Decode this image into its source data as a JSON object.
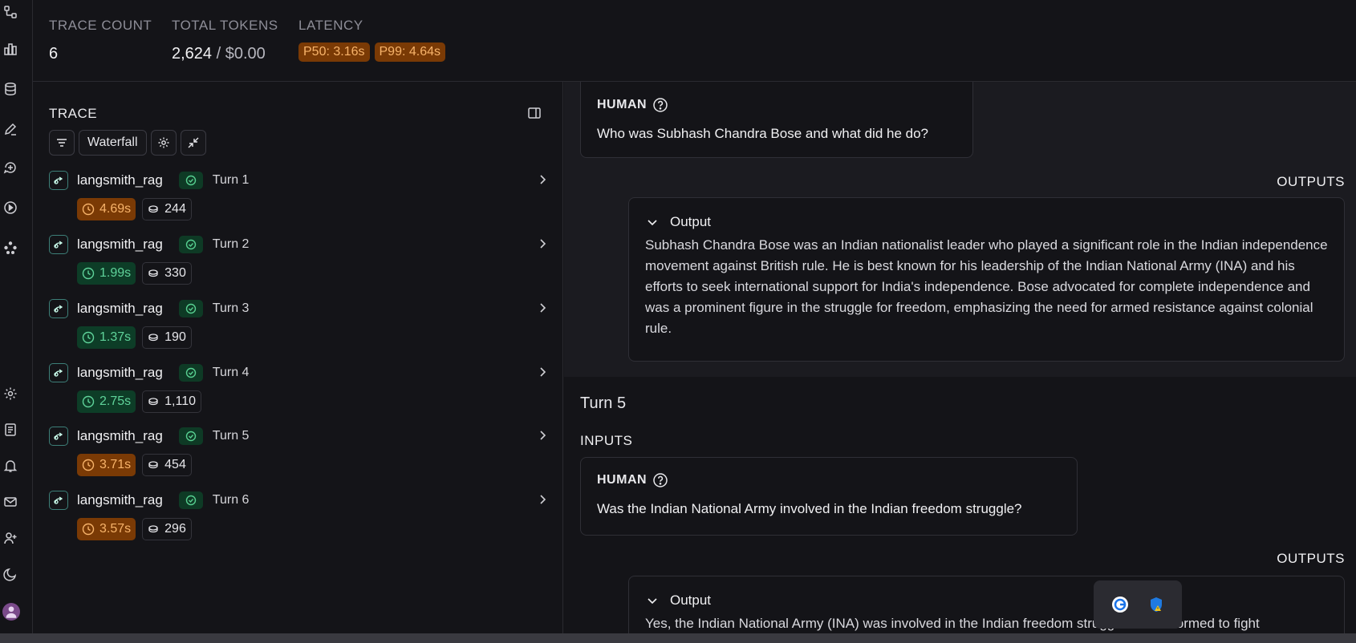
{
  "stats": {
    "trace_count_label": "TRACE COUNT",
    "trace_count_value": "6",
    "total_tokens_label": "TOTAL TOKENS",
    "total_tokens_value": "2,624",
    "total_tokens_separator": " / ",
    "total_cost_value": "$0.00",
    "latency_label": "LATENCY",
    "p50": "P50: 3.16s",
    "p99": "P99: 4.64s"
  },
  "trace_panel": {
    "title": "TRACE",
    "view_mode": "Waterfall",
    "runs": [
      {
        "name": "langsmith_rag",
        "turn": "Turn 1",
        "latency": "4.69s",
        "latency_status": "slow",
        "tokens": "244"
      },
      {
        "name": "langsmith_rag",
        "turn": "Turn 2",
        "latency": "1.99s",
        "latency_status": "fast",
        "tokens": "330"
      },
      {
        "name": "langsmith_rag",
        "turn": "Turn 3",
        "latency": "1.37s",
        "latency_status": "fast",
        "tokens": "190"
      },
      {
        "name": "langsmith_rag",
        "turn": "Turn 4",
        "latency": "2.75s",
        "latency_status": "fast",
        "tokens": "1,110"
      },
      {
        "name": "langsmith_rag",
        "turn": "Turn 5",
        "latency": "3.71s",
        "latency_status": "slow",
        "tokens": "454"
      },
      {
        "name": "langsmith_rag",
        "turn": "Turn 6",
        "latency": "3.57s",
        "latency_status": "slow",
        "tokens": "296"
      }
    ]
  },
  "detail": {
    "turn4": {
      "human_label": "HUMAN",
      "human_message": "Who was Subhash Chandra Bose and what did he do?",
      "outputs_label": "OUTPUTS",
      "output_label": "Output",
      "output_text": "Subhash Chandra Bose was an Indian nationalist leader who played a significant role in the Indian independence movement against British rule. He is best known for his leadership of the Indian National Army (INA) and his efforts to seek international support for India's independence. Bose advocated for complete independence and was a prominent figure in the struggle for freedom, emphasizing the need for armed resistance against colonial rule."
    },
    "turn5": {
      "title": "Turn 5",
      "inputs_label": "INPUTS",
      "human_label": "HUMAN",
      "human_message": "Was the Indian National Army involved in the Indian freedom struggle?",
      "outputs_label": "OUTPUTS",
      "output_label": "Output",
      "output_text": "Yes, the Indian National Army (INA) was involved in the Indian freedom struggle. It was formed to fight"
    }
  },
  "colors": {
    "background": "#141418",
    "detail_background": "#1b1b20",
    "latency_slow_bg": "#7a3a05",
    "latency_slow_fg": "#f7b36a",
    "latency_fast_bg": "#0d3d27",
    "latency_fast_fg": "#5fd39a",
    "chain_border": "#3d7f78"
  },
  "icons": {
    "rail": [
      "projects-icon",
      "dashboards-icon",
      "datasets-icon",
      "annotation-icon",
      "prompts-icon",
      "playground-icon",
      "deployments-icon",
      "settings-icon",
      "docs-icon",
      "alerts-icon",
      "mail-icon",
      "add-user-icon",
      "theme-icon"
    ],
    "floating": [
      "grammarly-icon",
      "security-shield-icon"
    ]
  }
}
